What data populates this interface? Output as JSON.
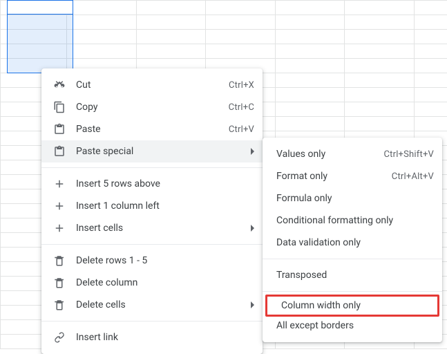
{
  "selection": {
    "rows": 5,
    "cols": 1
  },
  "menu": {
    "cut": {
      "label": "Cut",
      "shortcut": "Ctrl+X"
    },
    "copy": {
      "label": "Copy",
      "shortcut": "Ctrl+C"
    },
    "paste": {
      "label": "Paste",
      "shortcut": "Ctrl+V"
    },
    "paste_special": {
      "label": "Paste special"
    },
    "insert_rows": {
      "label": "Insert 5 rows above"
    },
    "insert_cols": {
      "label": "Insert 1 column left"
    },
    "insert_cells": {
      "label": "Insert cells"
    },
    "delete_rows": {
      "label": "Delete rows 1 - 5"
    },
    "delete_column": {
      "label": "Delete column"
    },
    "delete_cells": {
      "label": "Delete cells"
    },
    "insert_link": {
      "label": "Insert link"
    }
  },
  "submenu": {
    "values_only": {
      "label": "Values only",
      "shortcut": "Ctrl+Shift+V"
    },
    "format_only": {
      "label": "Format only",
      "shortcut": "Ctrl+Alt+V"
    },
    "formula_only": {
      "label": "Formula only"
    },
    "conditional_fmt": {
      "label": "Conditional formatting only"
    },
    "data_validation": {
      "label": "Data validation only"
    },
    "transposed": {
      "label": "Transposed"
    },
    "column_width": {
      "label": "Column width only"
    },
    "all_except_borders": {
      "label": "All except borders"
    }
  }
}
